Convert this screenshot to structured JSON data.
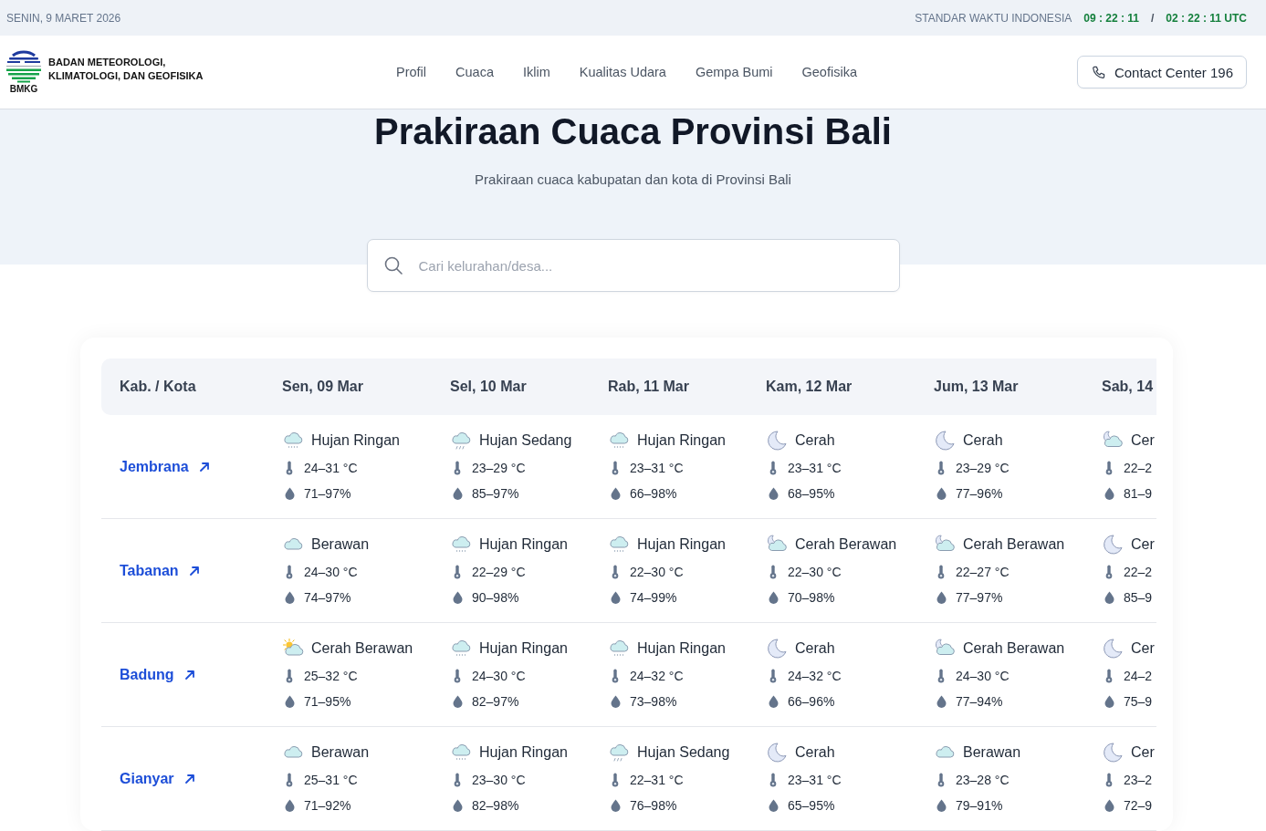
{
  "top_bar": {
    "date": "SENIN, 9 MARET 2026",
    "time_label": "STANDAR WAKTU INDONESIA",
    "local_time": "09 : 22 : 11",
    "separator": "/",
    "utc_time": "02 : 22 : 11 UTC"
  },
  "header": {
    "logo_text": "BMKG",
    "org_name_lines": [
      "BADAN METEOROLOGI,",
      "KLIMATOLOGI, DAN GEOFISIKA"
    ],
    "nav": [
      "Profil",
      "Cuaca",
      "Iklim",
      "Kualitas Udara",
      "Gempa Bumi",
      "Geofisika"
    ],
    "contact_button": "Contact Center 196"
  },
  "hero": {
    "title": "Prakiraan Cuaca Provinsi Bali",
    "subtitle": "Prakiraan cuaca kabupatan dan kota di Provinsi Bali"
  },
  "search": {
    "placeholder": "Cari kelurahan/desa..."
  },
  "table": {
    "columns": [
      "Kab. / Kota",
      "Sen, 09 Mar",
      "Sel, 10 Mar",
      "Rab, 11 Mar",
      "Kam, 12 Mar",
      "Jum, 13 Mar",
      "Sab, 14"
    ],
    "rows": [
      {
        "city": "Jembrana",
        "forecasts": [
          {
            "kind": "light-rain",
            "condition": "Hujan Ringan",
            "temperature": "24–31 °C",
            "humidity": "71–97%"
          },
          {
            "kind": "moderate-rain",
            "condition": "Hujan Sedang",
            "temperature": "23–29 °C",
            "humidity": "85–97%"
          },
          {
            "kind": "light-rain",
            "condition": "Hujan Ringan",
            "temperature": "23–31 °C",
            "humidity": "66–98%"
          },
          {
            "kind": "clear-night",
            "condition": "Cerah",
            "temperature": "23–31 °C",
            "humidity": "68–95%"
          },
          {
            "kind": "clear-night",
            "condition": "Cerah",
            "temperature": "23–29 °C",
            "humidity": "77–96%"
          },
          {
            "kind": "partly-cloudy-night",
            "condition": "Cer",
            "temperature": "22–2",
            "humidity": "81–9"
          }
        ]
      },
      {
        "city": "Tabanan",
        "forecasts": [
          {
            "kind": "cloudy",
            "condition": "Berawan",
            "temperature": "24–30 °C",
            "humidity": "74–97%"
          },
          {
            "kind": "light-rain",
            "condition": "Hujan Ringan",
            "temperature": "22–29 °C",
            "humidity": "90–98%"
          },
          {
            "kind": "light-rain",
            "condition": "Hujan Ringan",
            "temperature": "22–30 °C",
            "humidity": "74–99%"
          },
          {
            "kind": "partly-cloudy-night",
            "condition": "Cerah Berawan",
            "temperature": "22–30 °C",
            "humidity": "70–98%"
          },
          {
            "kind": "partly-cloudy-night",
            "condition": "Cerah Berawan",
            "temperature": "22–27 °C",
            "humidity": "77–97%"
          },
          {
            "kind": "clear-night",
            "condition": "Cer",
            "temperature": "22–2",
            "humidity": "85–9"
          }
        ]
      },
      {
        "city": "Badung",
        "forecasts": [
          {
            "kind": "partly-cloudy-day",
            "condition": "Cerah Berawan",
            "temperature": "25–32 °C",
            "humidity": "71–95%"
          },
          {
            "kind": "light-rain",
            "condition": "Hujan Ringan",
            "temperature": "24–30 °C",
            "humidity": "82–97%"
          },
          {
            "kind": "light-rain",
            "condition": "Hujan Ringan",
            "temperature": "24–32 °C",
            "humidity": "73–98%"
          },
          {
            "kind": "clear-night",
            "condition": "Cerah",
            "temperature": "24–32 °C",
            "humidity": "66–96%"
          },
          {
            "kind": "partly-cloudy-night",
            "condition": "Cerah Berawan",
            "temperature": "24–30 °C",
            "humidity": "77–94%"
          },
          {
            "kind": "clear-night",
            "condition": "Cer",
            "temperature": "24–2",
            "humidity": "75–9"
          }
        ]
      },
      {
        "city": "Gianyar",
        "forecasts": [
          {
            "kind": "cloudy",
            "condition": "Berawan",
            "temperature": "25–31 °C",
            "humidity": "71–92%"
          },
          {
            "kind": "light-rain",
            "condition": "Hujan Ringan",
            "temperature": "23–30 °C",
            "humidity": "82–98%"
          },
          {
            "kind": "moderate-rain",
            "condition": "Hujan Sedang",
            "temperature": "22–31 °C",
            "humidity": "76–98%"
          },
          {
            "kind": "clear-night",
            "condition": "Cerah",
            "temperature": "23–31 °C",
            "humidity": "65–95%"
          },
          {
            "kind": "cloudy",
            "condition": "Berawan",
            "temperature": "23–28 °C",
            "humidity": "79–91%"
          },
          {
            "kind": "clear-night",
            "condition": "Cer",
            "temperature": "23–2",
            "humidity": "72–9"
          }
        ]
      }
    ]
  }
}
